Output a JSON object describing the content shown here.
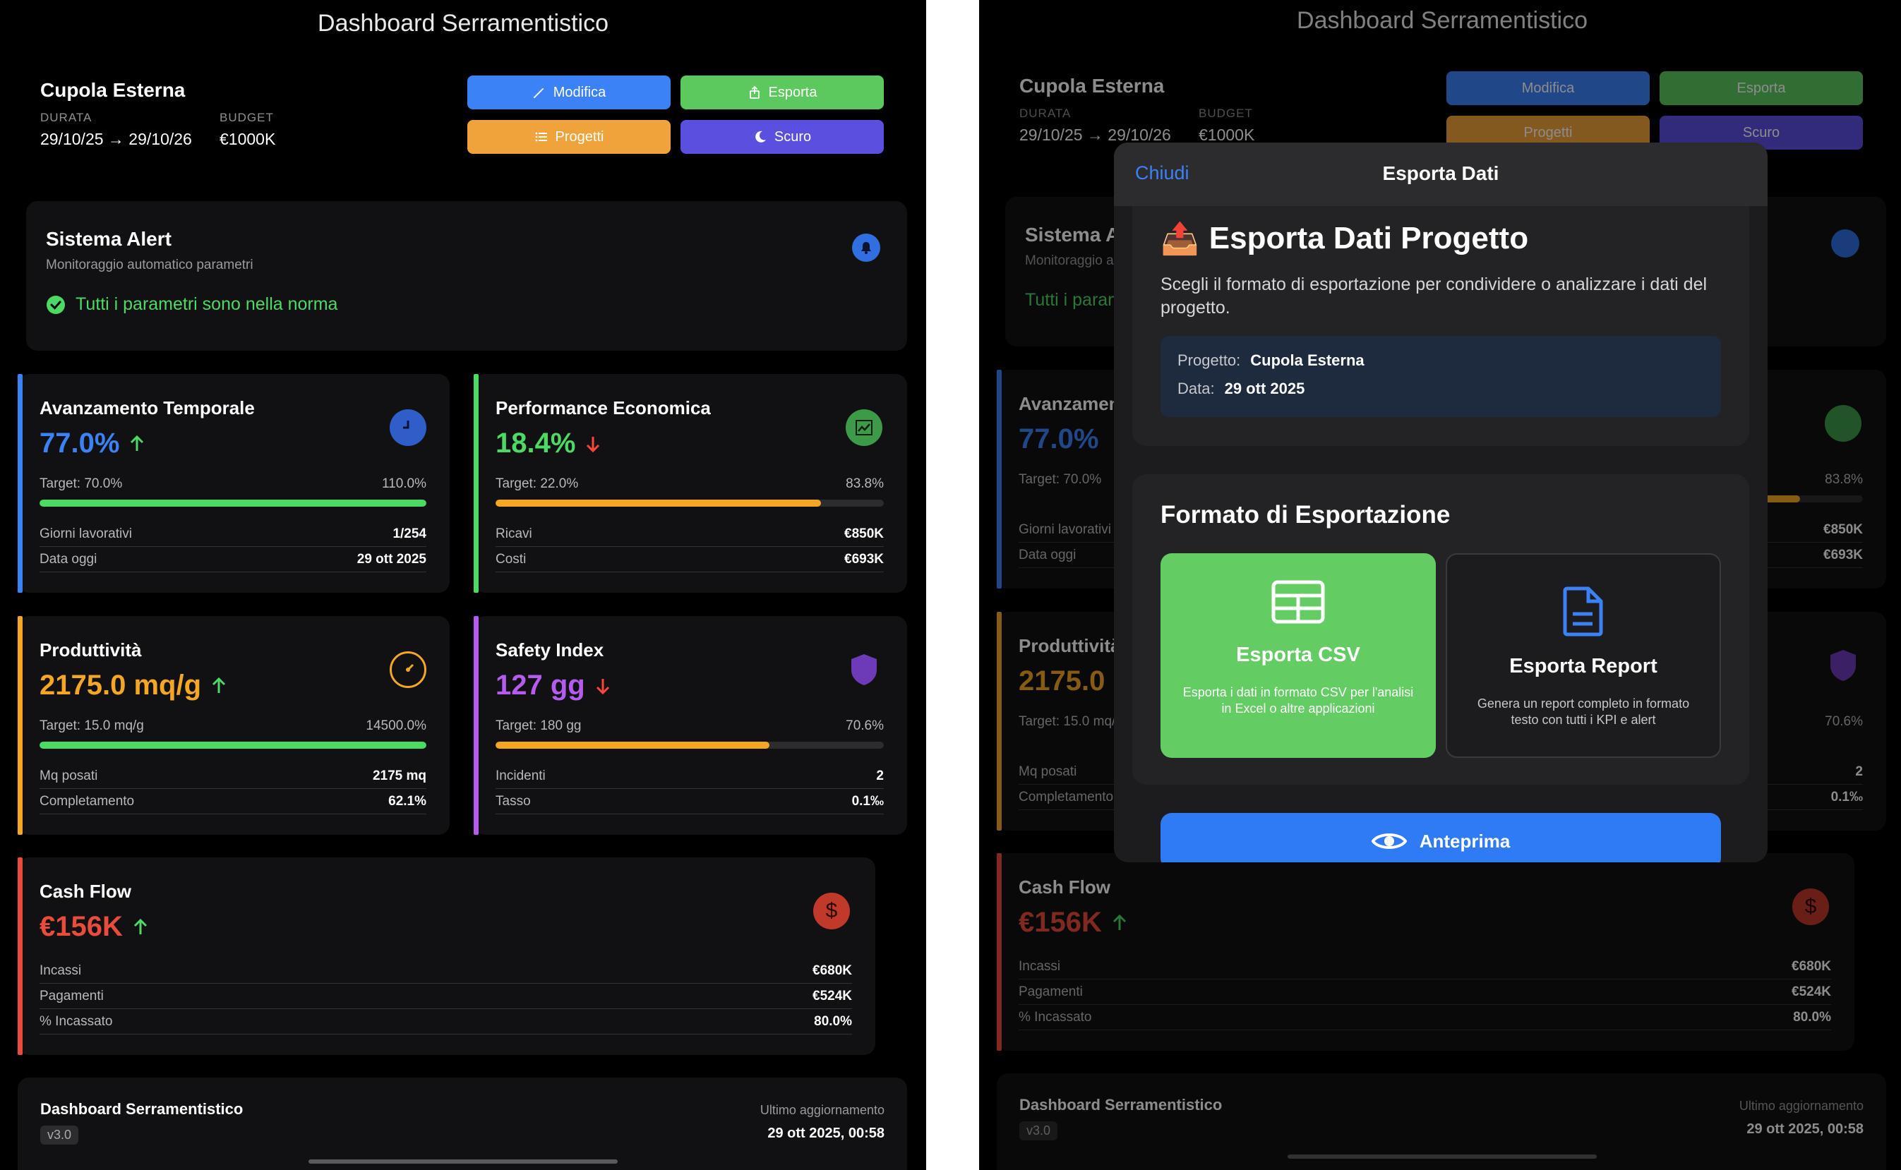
{
  "app_title": "Dashboard Serramentistico",
  "project": {
    "name": "Cupola Esterna",
    "duration_label": "DURATA",
    "duration_value": "29/10/25 → 29/10/26",
    "budget_label": "BUDGET",
    "budget_value": "€1000K"
  },
  "toolbar": {
    "edit_label": "Modifica",
    "export_label": "Esporta",
    "projects_label": "Progetti",
    "theme_label": "Scuro"
  },
  "alerts": {
    "title": "Sistema Alert",
    "subtitle": "Monitoraggio automatico parametri",
    "status": "Tutti i parametri sono nella norma"
  },
  "kpis": {
    "temporal": {
      "title": "Avanzamento Temporale",
      "value": "77.0%",
      "trend": "up",
      "color": "#3b82f6",
      "target": "Target: 70.0%",
      "ratio": "110.0%",
      "progress": 1.0,
      "progress_color": "#4cd964",
      "rows": [
        {
          "label": "Giorni lavorativi",
          "value": "1/254"
        },
        {
          "label": "Data oggi",
          "value": "29 ott 2025"
        }
      ]
    },
    "economic": {
      "title": "Performance Economica",
      "value": "18.4%",
      "trend": "down",
      "color": "#4cd964",
      "target": "Target: 22.0%",
      "ratio": "83.8%",
      "progress": 0.838,
      "progress_color": "#f5a623",
      "rows": [
        {
          "label": "Ricavi",
          "value": "€850K"
        },
        {
          "label": "Costi",
          "value": "€693K"
        }
      ]
    },
    "productivity": {
      "title": "Produttività",
      "value": "2175.0 mq/g",
      "trend": "up",
      "color": "#f5a623",
      "target": "Target: 15.0 mq/g",
      "ratio": "14500.0%",
      "progress": 1.0,
      "progress_color": "#4cd964",
      "rows": [
        {
          "label": "Mq posati",
          "value": "2175 mq"
        },
        {
          "label": "Completamento",
          "value": "62.1%"
        }
      ]
    },
    "safety": {
      "title": "Safety Index",
      "value": "127 gg",
      "trend": "down",
      "color": "#b45cf0",
      "target": "Target: 180 gg",
      "ratio": "70.6%",
      "progress": 0.706,
      "progress_color": "#f5a623",
      "rows": [
        {
          "label": "Incidenti",
          "value": "2"
        },
        {
          "label": "Tasso",
          "value": "0.1‰"
        }
      ]
    },
    "cashflow": {
      "title": "Cash Flow",
      "value": "€156K",
      "trend": "up",
      "color": "#e74c3c",
      "rows": [
        {
          "label": "Incassi",
          "value": "€680K"
        },
        {
          "label": "Pagamenti",
          "value": "€524K"
        },
        {
          "label": "% Incassato",
          "value": "80.0%"
        }
      ]
    }
  },
  "footer": {
    "title": "Dashboard Serramentistico",
    "version": "v3.0",
    "updated_label": "Ultimo aggiornamento",
    "updated_value": "29 ott 2025, 00:58"
  },
  "modal": {
    "close_label": "Chiudi",
    "title": "Esporta Dati",
    "heading_emoji": "📤",
    "heading": "Esporta Dati Progetto",
    "description": "Scegli il formato di esportazione per condividere o analizzare i dati del progetto.",
    "info_project_label": "Progetto:",
    "info_project_value": "Cupola Esterna",
    "info_date_label": "Data:",
    "info_date_value": "29 ott 2025",
    "format_heading": "Formato di Esportazione",
    "csv_title": "Esporta CSV",
    "csv_desc": "Esporta i dati in formato CSV per l'analisi in Excel o altre applicazioni",
    "report_title": "Esporta Report",
    "report_desc": "Genera un report completo in formato testo con tutti i KPI e alert",
    "preview_label": "Anteprima",
    "selected_format": "Esporta CSV"
  },
  "colors": {
    "blue": "#3b82f6",
    "green": "#4cd964",
    "orange": "#f5a623",
    "purple": "#5b4fe0",
    "red": "#e74c3c"
  }
}
